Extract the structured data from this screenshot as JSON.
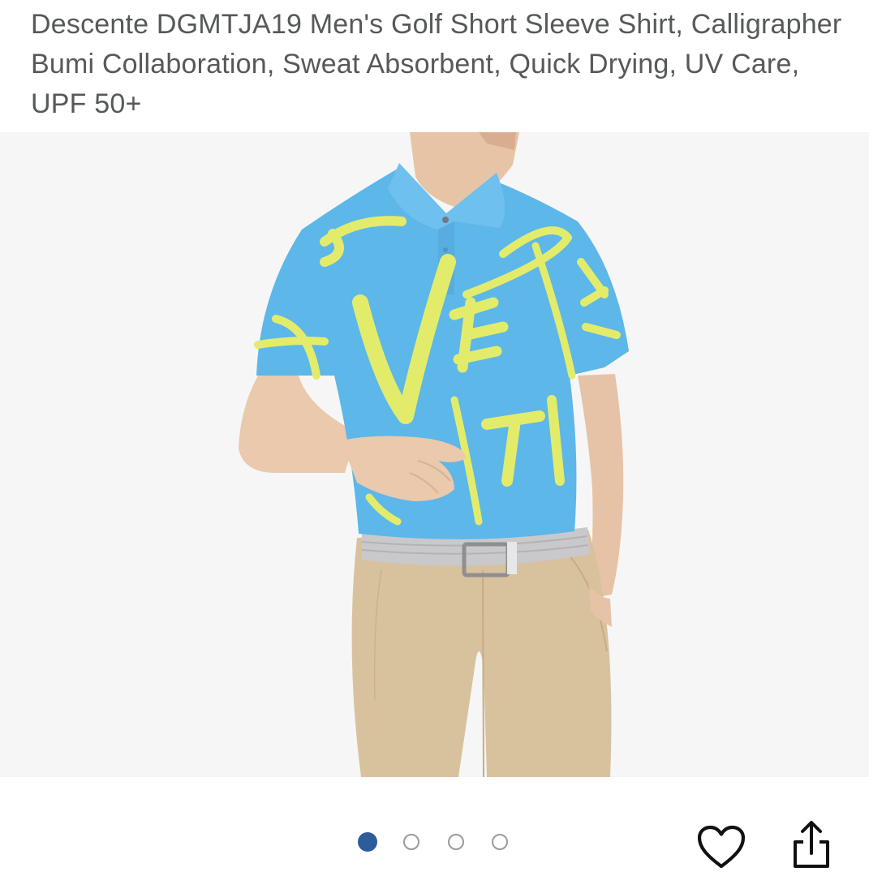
{
  "product": {
    "title": "Descente DGMTJA19 Men's Golf Short Sleeve Shirt, Calligrapher Bumi Collaboration, Sweat Absorbent, Quick Drying, UV Care, UPF 50+"
  },
  "image": {
    "alt": "Model wearing a light blue polo shirt with yellow calligraphy print, beige pants and gray braided belt",
    "colors": {
      "shirt": "#5db7e8",
      "print": "#e3ec6a",
      "pants": "#d8c29e",
      "belt": "#c9c9cc",
      "skin": "#eac9ad",
      "background": "#f6f6f6"
    }
  },
  "carousel": {
    "count": 4,
    "active_index": 0,
    "active_color": "#2e5c99",
    "inactive_color": "#9a9a9a"
  },
  "actions": {
    "favorite_icon": "heart-icon",
    "share_icon": "share-icon"
  }
}
